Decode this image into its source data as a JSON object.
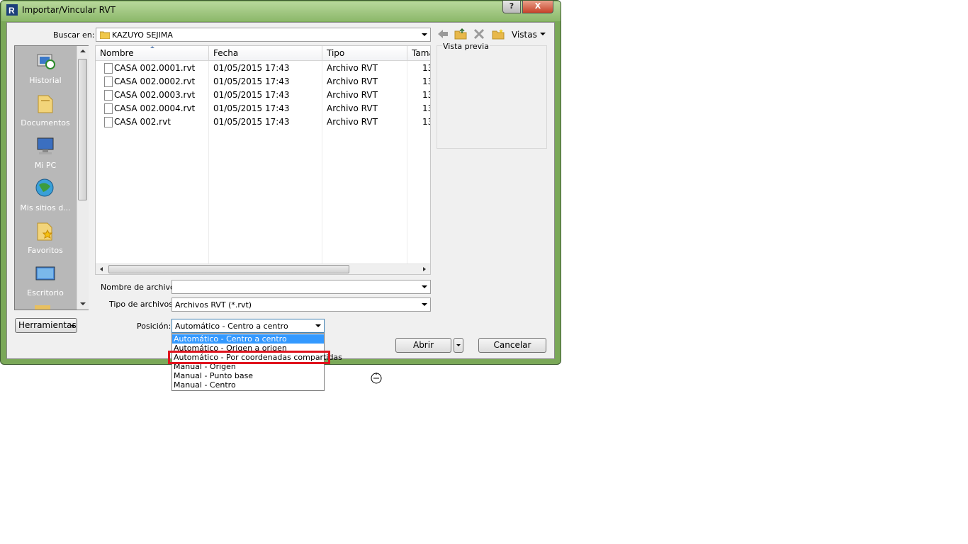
{
  "window": {
    "title": "Importar/Vincular RVT",
    "help_label": "?",
    "close_label": "X"
  },
  "lookin": {
    "label": "Buscar en:",
    "value": "KAZUYO SEJIMA"
  },
  "toolbar": {
    "back_icon": "back-arrow-icon",
    "up_folder_icon": "up-folder-icon",
    "delete_icon": "delete-icon",
    "new_folder_icon": "new-folder-icon",
    "views_label": "Vistas"
  },
  "preview": {
    "label": "Vista previa"
  },
  "places": [
    {
      "label": "Historial",
      "icon": "history-icon"
    },
    {
      "label": "Documentos",
      "icon": "documents-folder-icon"
    },
    {
      "label": "Mi PC",
      "icon": "my-computer-icon"
    },
    {
      "label": "Mis sitios d...",
      "icon": "network-places-icon"
    },
    {
      "label": "Favoritos",
      "icon": "favorites-folder-icon"
    },
    {
      "label": "Escritorio",
      "icon": "desktop-icon"
    }
  ],
  "columns": [
    "Nombre",
    "Fecha",
    "Tipo",
    "Tama"
  ],
  "files": [
    {
      "name": "CASA 002.0001.rvt",
      "date": "01/05/2015 17:43",
      "type": "Archivo RVT",
      "size": "13"
    },
    {
      "name": "CASA 002.0002.rvt",
      "date": "01/05/2015 17:43",
      "type": "Archivo RVT",
      "size": "13"
    },
    {
      "name": "CASA 002.0003.rvt",
      "date": "01/05/2015 17:43",
      "type": "Archivo RVT",
      "size": "13"
    },
    {
      "name": "CASA 002.0004.rvt",
      "date": "01/05/2015 17:43",
      "type": "Archivo RVT",
      "size": "13"
    },
    {
      "name": "CASA 002.rvt",
      "date": "01/05/2015 17:43",
      "type": "Archivo RVT",
      "size": "13"
    }
  ],
  "filename": {
    "label": "Nombre de archivo:",
    "value": ""
  },
  "filetype": {
    "label": "Tipo de archivos:",
    "value": "Archivos RVT  (*.rvt)"
  },
  "position": {
    "label": "Posición:",
    "value": "Automático - Centro a centro",
    "options": [
      "Automático - Centro a centro",
      "Automático - Origen a origen",
      "Automático - Por coordenadas compartidas",
      "Manual - Origen",
      "Manual - Punto base",
      "Manual - Centro"
    ],
    "selected_index": 0,
    "highlighted_index": 2
  },
  "buttons": {
    "tools": "Herramientas",
    "open": "Abrir",
    "cancel": "Cancelar"
  },
  "colors": {
    "selection": "#3399ff",
    "annotation_red": "#e0141e",
    "frame_green": "#8cb86a"
  }
}
